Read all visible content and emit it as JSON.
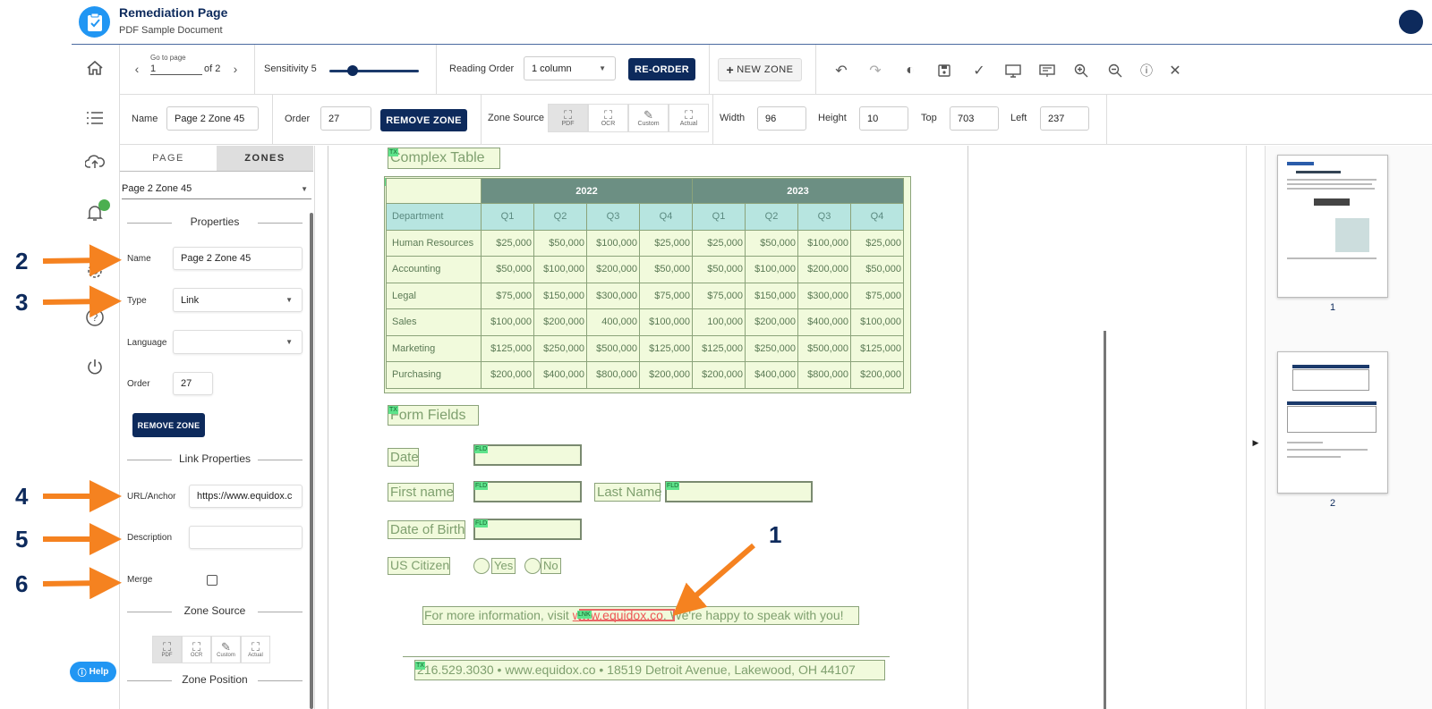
{
  "header": {
    "title": "Remediation Page",
    "subtitle": "PDF Sample Document"
  },
  "toolbar": {
    "go_to_page_label": "Go to page",
    "page_value": "1",
    "page_of": "of 2",
    "sensitivity_label": "Sensitivity 5",
    "sensitivity_value": 5,
    "reading_order_label": "Reading Order",
    "reading_order_value": "1 column",
    "reorder_label": "RE-ORDER",
    "new_zone_label": "NEW ZONE",
    "tools": [
      "undo-icon",
      "redo-icon",
      "contrast-icon",
      "save-icon",
      "check-icon",
      "monitor-icon",
      "presentation-icon",
      "zoom-in-icon",
      "zoom-out-icon",
      "info-icon",
      "close-icon"
    ]
  },
  "zone_bar": {
    "name_label": "Name",
    "name_value": "Page 2 Zone 45",
    "order_label": "Order",
    "order_value": "27",
    "remove_label": "REMOVE ZONE",
    "zone_source_label": "Zone Source",
    "sources": [
      {
        "tag": "PDF",
        "label": "PDF"
      },
      {
        "tag": "OCR",
        "label": "OCR"
      },
      {
        "tag": "",
        "label": "Custom"
      },
      {
        "tag": "ACT",
        "label": "Actual"
      }
    ],
    "width_label": "Width",
    "width_value": "96",
    "height_label": "Height",
    "height_value": "10",
    "top_label": "Top",
    "top_value": "703",
    "left_label": "Left",
    "left_value": "237"
  },
  "panel": {
    "tabs": [
      "PAGE",
      "ZONES"
    ],
    "zone_select": "Page 2 Zone 45",
    "properties_header": "Properties",
    "name_label": "Name",
    "name_value": "Page 2 Zone 45",
    "type_label": "Type",
    "type_value": "Link",
    "language_label": "Language",
    "language_value": "",
    "order_label": "Order",
    "order_value": "27",
    "remove_label": "REMOVE ZONE",
    "link_header": "Link Properties",
    "url_label": "URL/Anchor",
    "url_value": "https://www.equidox.c",
    "description_label": "Description",
    "description_value": "",
    "merge_label": "Merge",
    "zone_source_header": "Zone Source",
    "sources": [
      {
        "tag": "PDF",
        "label": "PDF"
      },
      {
        "tag": "OCR",
        "label": "OCR"
      },
      {
        "tag": "",
        "label": "Custom"
      },
      {
        "tag": "ACT",
        "label": "Actual"
      }
    ],
    "zone_position_header": "Zone Position"
  },
  "document": {
    "complex_table_title": "Complex Table",
    "year_headers": [
      "2022",
      "2023"
    ],
    "col_headers": [
      "Department",
      "Q1",
      "Q2",
      "Q3",
      "Q4",
      "Q1",
      "Q2",
      "Q3",
      "Q4"
    ],
    "rows": [
      [
        "Human Resources",
        "$25,000",
        "$50,000",
        "$100,000",
        "$25,000",
        "$25,000",
        "$50,000",
        "$100,000",
        "$25,000"
      ],
      [
        "Accounting",
        "$50,000",
        "$100,000",
        "$200,000",
        "$50,000",
        "$50,000",
        "$100,000",
        "$200,000",
        "$50,000"
      ],
      [
        "Legal",
        "$75,000",
        "$150,000",
        "$300,000",
        "$75,000",
        "$75,000",
        "$150,000",
        "$300,000",
        "$75,000"
      ],
      [
        "Sales",
        "$100,000",
        "$200,000",
        "400,000",
        "$100,000",
        "100,000",
        "$200,000",
        "$400,000",
        "$100,000"
      ],
      [
        "Marketing",
        "$125,000",
        "$250,000",
        "$500,000",
        "$125,000",
        "$125,000",
        "$250,000",
        "$500,000",
        "$125,000"
      ],
      [
        "Purchasing",
        "$200,000",
        "$400,000",
        "$800,000",
        "$200,000",
        "$200,000",
        "$400,000",
        "$800,000",
        "$200,000"
      ]
    ],
    "form_fields_title": "Form Fields",
    "date_label": "Date",
    "first_name_label": "First name",
    "last_name_label": "Last Name",
    "dob_label": "Date of Birth",
    "citizen_label": "US Citizen",
    "yes_label": "Yes",
    "no_label": "No",
    "info_before": "For more information, visit ",
    "info_link": "www.equidox.co",
    "info_after": ". We're happy to speak with you!",
    "footer": "216.529.3030 • www.equidox.co • 18519 Detroit Avenue, Lakewood, OH 44107",
    "tags": {
      "tx": "TX",
      "tb": "TB",
      "fld": "FLD",
      "lnk": "LNK"
    }
  },
  "thumbnails": [
    {
      "number": "1"
    },
    {
      "number": "2"
    }
  ],
  "annotations": [
    "1",
    "2",
    "3",
    "4",
    "5",
    "6"
  ],
  "help_label": "Help",
  "colors": {
    "navy": "#0d2a5c",
    "accent": "#2196f3",
    "zone_fill": "#f1fadc",
    "zone_tag": "#5ee38b",
    "arrow": "#f58220"
  }
}
